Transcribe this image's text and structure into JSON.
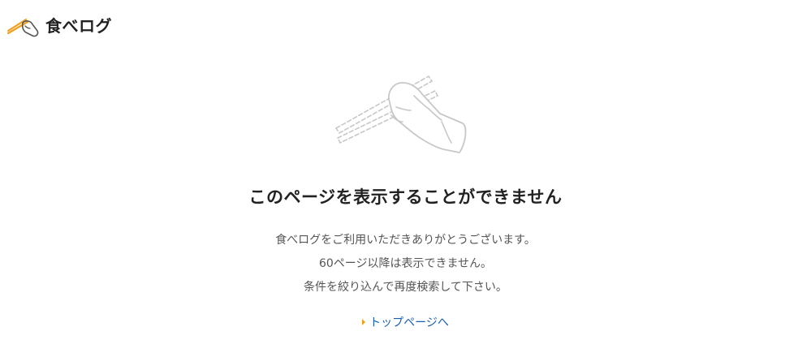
{
  "header": {
    "logo_text": "食べログ"
  },
  "main": {
    "title": "このページを表示することができません",
    "messages": [
      "食べログをご利用いただきありがとうございます。",
      "60ページ以降は表示できません。",
      "条件を絞り込んで再度検索して下さい。"
    ],
    "top_link_label": "トップページへ"
  },
  "colors": {
    "logo_accent": "#f0a020",
    "link": "#1a5fb4",
    "illustration_stroke": "#c8c8c8"
  },
  "icons": {
    "logo": "chopsticks-hand-icon",
    "illustration": "chopsticks-hand-illustration",
    "link_arrow": "caret-right-icon"
  }
}
